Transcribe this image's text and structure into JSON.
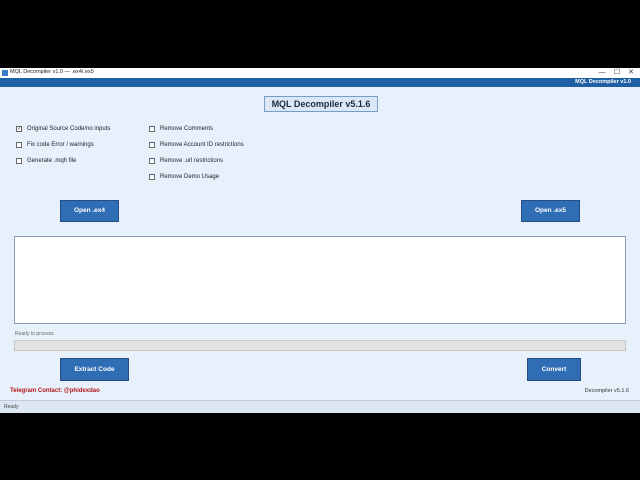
{
  "window": {
    "title": "MQL Decompiler v1.0 — .ex4/.ex5",
    "header_text": "MQL Decompiler v1.0",
    "controls": {
      "minimize": "—",
      "maximize": "☐",
      "close": "✕"
    }
  },
  "page_title": "MQL Decompiler v5.1.6",
  "options_left": [
    {
      "label": "Original Source Code/no inputs",
      "checked": true
    },
    {
      "label": "Fix code Error / warnings",
      "checked": false
    },
    {
      "label": "Generate .mqh file",
      "checked": false
    }
  ],
  "options_right": [
    {
      "label": "Remove Comments",
      "checked": false
    },
    {
      "label": "Remove Account ID restrictions",
      "checked": false
    },
    {
      "label": "Remove .url restrictions",
      "checked": false
    },
    {
      "label": "Remove Demo Usage",
      "checked": false
    }
  ],
  "buttons": {
    "open_ex4": "Open .ex4",
    "open_ex5": "Open .ex5",
    "extract": "Extract Code",
    "convert": "Convert"
  },
  "output_text": "",
  "progress": {
    "label": "Ready to process",
    "value": 0
  },
  "footer": {
    "telegram": "Telegram Contact: @phidexdao",
    "version": "Decompiler v5.1.6"
  },
  "status_bar": "Ready",
  "colors": {
    "accent": "#2f6db5",
    "header": "#1f5fa3",
    "contact": "#b01818"
  }
}
